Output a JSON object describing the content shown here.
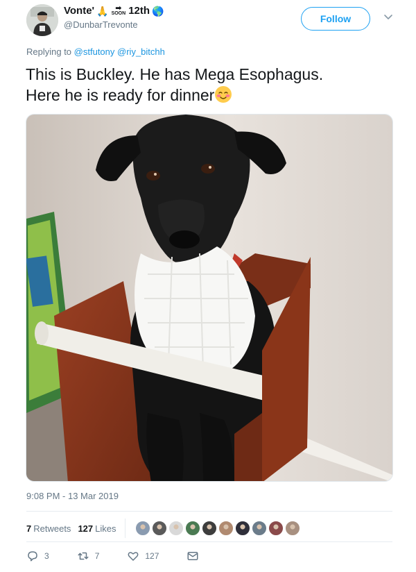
{
  "author": {
    "name_prefix": "Vonte'",
    "name_suffix": "12th",
    "emoji_pray": "🙏",
    "soon_label": "SOON",
    "soon_arrow": "➡",
    "emoji_globe": "🌎",
    "handle": "@DunbarTrevonte"
  },
  "follow": {
    "label": "Follow"
  },
  "reply": {
    "prefix": "Replying to",
    "mentions": [
      "@stfutony",
      "@riy_bitchh"
    ]
  },
  "tweet": {
    "line1": "This is Buckley. He has Mega Esophagus.",
    "line2": "Here he is ready for dinner",
    "emoji": "☺"
  },
  "meta": {
    "timestamp": "9:08 PM - 13 Mar 2019"
  },
  "stats": {
    "retweets_count": "7",
    "retweets_label": "Retweets",
    "likes_count": "127",
    "likes_label": "Likes",
    "liker_colors": [
      "#8a9bb0",
      "#5a5a5a",
      "#d9d9d9",
      "#4a7a52",
      "#3d3d3d",
      "#b08a70",
      "#2f2f3a",
      "#6b7c8a",
      "#8a4a4a",
      "#a89080"
    ]
  },
  "actions": {
    "reply_count": "3",
    "retweet_count": "7",
    "like_count": "127"
  },
  "colors": {
    "accent": "#1da1f2",
    "mention": "#1b95e0",
    "muted": "#657786"
  }
}
